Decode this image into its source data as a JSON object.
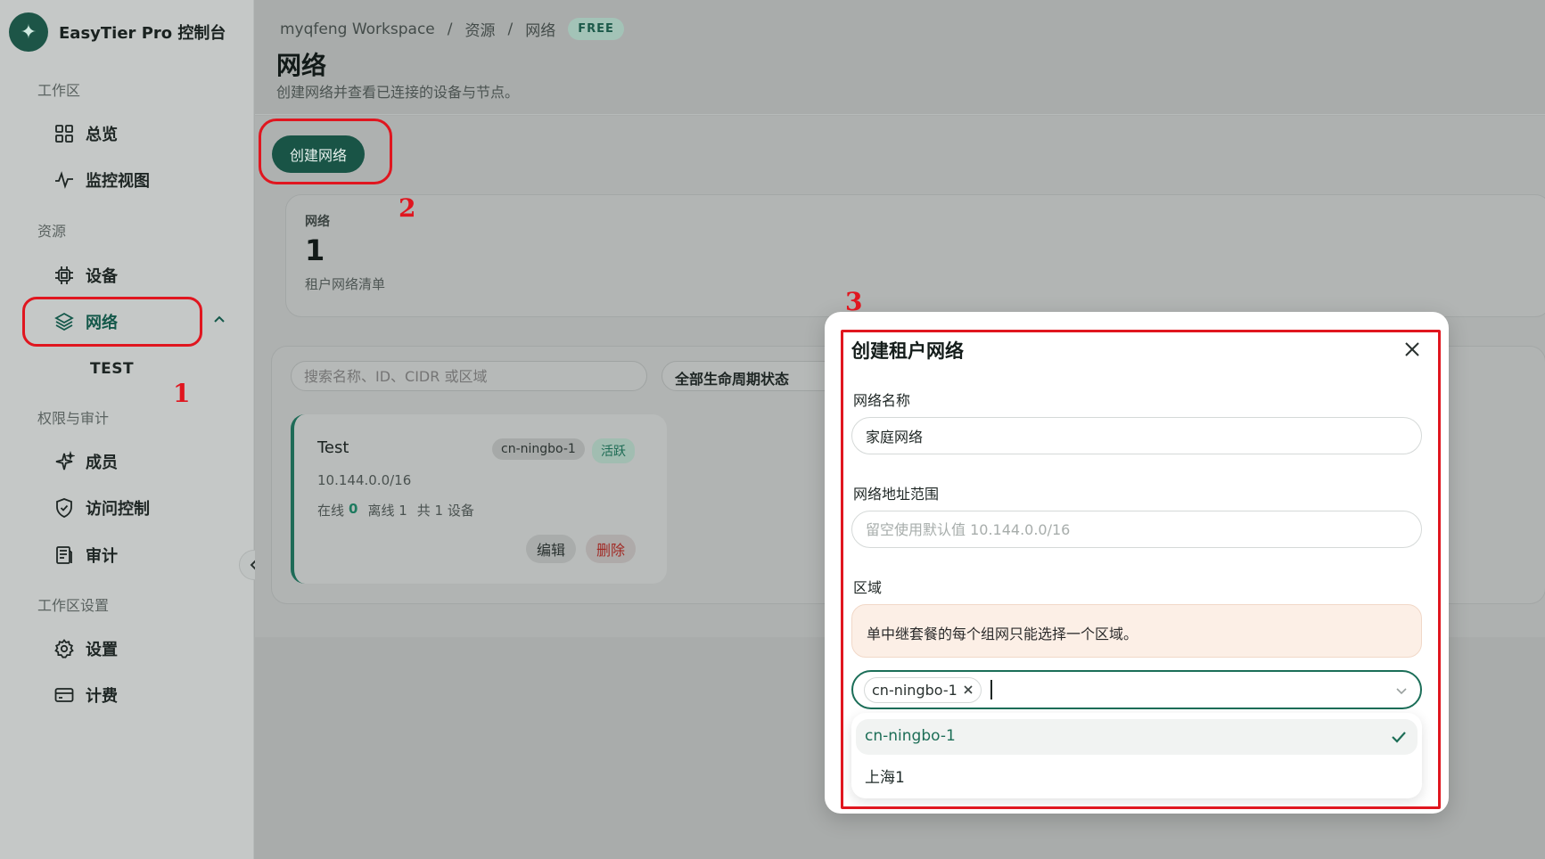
{
  "app": {
    "title": "EasyTier Pro 控制台"
  },
  "sidebar": {
    "sections": [
      {
        "label": "工作区"
      },
      {
        "label": "资源"
      },
      {
        "label": "权限与审计"
      },
      {
        "label": "工作区设置"
      }
    ],
    "items": [
      {
        "label": "总览",
        "icon": "grid-icon"
      },
      {
        "label": "监控视图",
        "icon": "activity-icon"
      },
      {
        "label": "设备",
        "icon": "chip-icon"
      },
      {
        "label": "网络",
        "icon": "layers-icon",
        "active": true
      },
      {
        "label": "TEST",
        "sub": true
      },
      {
        "label": "成员",
        "icon": "sparkle-icon"
      },
      {
        "label": "访问控制",
        "icon": "shield-icon"
      },
      {
        "label": "审计",
        "icon": "document-icon"
      },
      {
        "label": "设置",
        "icon": "gear-icon"
      },
      {
        "label": "计费",
        "icon": "card-icon"
      }
    ]
  },
  "breadcrumb": {
    "workspace": "myqfeng Workspace",
    "sep": "/",
    "resources": "资源",
    "current": "网络",
    "plan_badge": "FREE"
  },
  "page": {
    "title": "网络",
    "subtitle": "创建网络并查看已连接的设备与节点。",
    "create_button": "创建网络"
  },
  "stats": {
    "label": "网络",
    "value": "1",
    "desc": "租户网络清单"
  },
  "filters": {
    "search_placeholder": "搜索名称、ID、CIDR 或区域",
    "lifecycle": "全部生命周期状态"
  },
  "network_card": {
    "name": "Test",
    "region": "cn-ningbo-1",
    "status": "活跃",
    "cidr": "10.144.0.0/16",
    "online_label": "在线",
    "online": "0",
    "offline_label": "离线 1",
    "total_label": "共 1 设备",
    "edit": "编辑",
    "delete": "删除"
  },
  "modal": {
    "title": "创建租户网络",
    "name_label": "网络名称",
    "name_value": "家庭网络",
    "cidr_label": "网络地址范围",
    "cidr_placeholder": "留空使用默认值 10.144.0.0/16",
    "region_label": "区域",
    "region_notice": "单中继套餐的每个组网只能选择一个区域。",
    "selected_tag": "cn-ningbo-1",
    "options": [
      "cn-ningbo-1",
      "上海1"
    ]
  },
  "annotations": [
    "1",
    "2",
    "3"
  ],
  "colors": {
    "accent": "#195446",
    "annotation": "#e0161f",
    "active_text": "#1d6e57"
  }
}
